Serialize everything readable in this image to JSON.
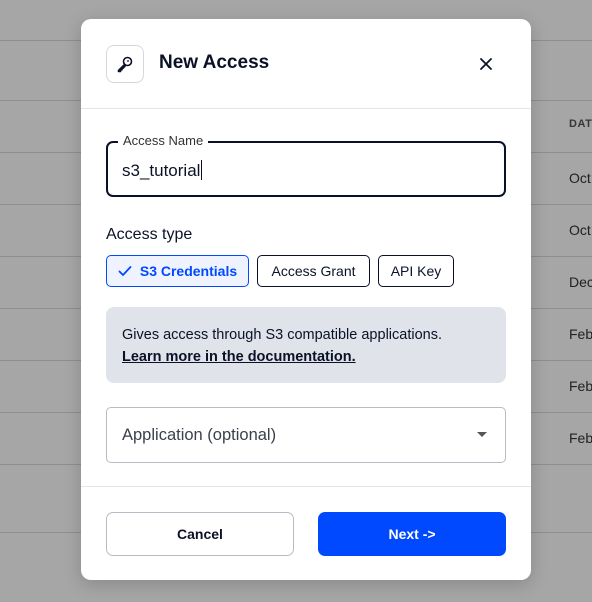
{
  "background": {
    "column_header": "DAT",
    "rows": [
      "Oct",
      "Oct",
      "Dec",
      "Feb",
      "Feb",
      "Feb"
    ]
  },
  "modal": {
    "title": "New Access",
    "icons": {
      "header": "key-icon",
      "close": "close-icon",
      "selected": "check-icon",
      "select": "chevron-down-icon"
    },
    "access_name": {
      "label": "Access Name",
      "value": "s3_tutorial"
    },
    "access_type": {
      "label": "Access type",
      "options": [
        "S3 Credentials",
        "Access Grant",
        "API Key"
      ],
      "selected": "S3 Credentials"
    },
    "info": {
      "text": "Gives access through S3 compatible applications.",
      "link": "Learn more in the documentation."
    },
    "application_select": {
      "placeholder": "Application (optional)"
    },
    "buttons": {
      "cancel": "Cancel",
      "next": "Next ->"
    }
  },
  "colors": {
    "primary": "#0149ff",
    "text": "#0b1227",
    "info_bg": "#e0e3ea"
  }
}
